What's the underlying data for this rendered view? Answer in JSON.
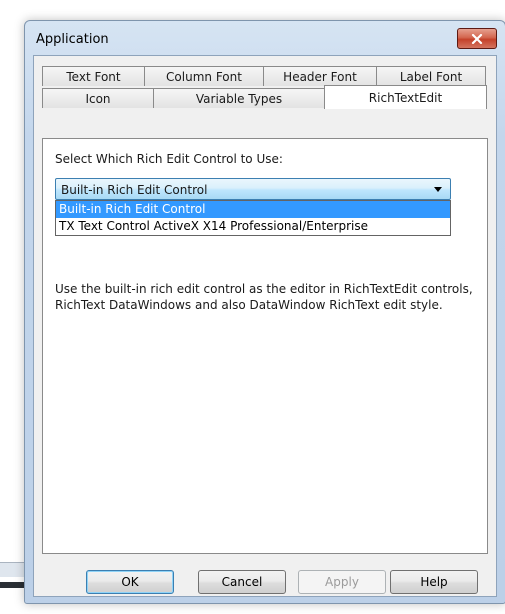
{
  "window": {
    "title": "Application",
    "close_icon": "close-x-icon"
  },
  "tabs": {
    "row1": [
      "Text Font",
      "Column Font",
      "Header Font",
      "Label Font"
    ],
    "row2": [
      "Icon",
      "Variable Types",
      "RichTextEdit"
    ],
    "active": "RichTextEdit"
  },
  "panel": {
    "label": "Select Which Rich Edit Control to Use:",
    "combo_value": "Built-in Rich Edit Control",
    "options": [
      "Built-in Rich Edit Control",
      "TX Text Control ActiveX X14 Professional/Enterprise"
    ],
    "selected_option_index": 0,
    "description_line1": "Use the built-in rich edit control as the editor in RichTextEdit controls,",
    "description_line2": "RichText DataWindows and also DataWindow RichText edit style."
  },
  "buttons": {
    "ok": "OK",
    "cancel": "Cancel",
    "apply": "Apply",
    "help": "Help"
  },
  "colors": {
    "selection": "#3399ff",
    "close_button": "#c4412a"
  }
}
